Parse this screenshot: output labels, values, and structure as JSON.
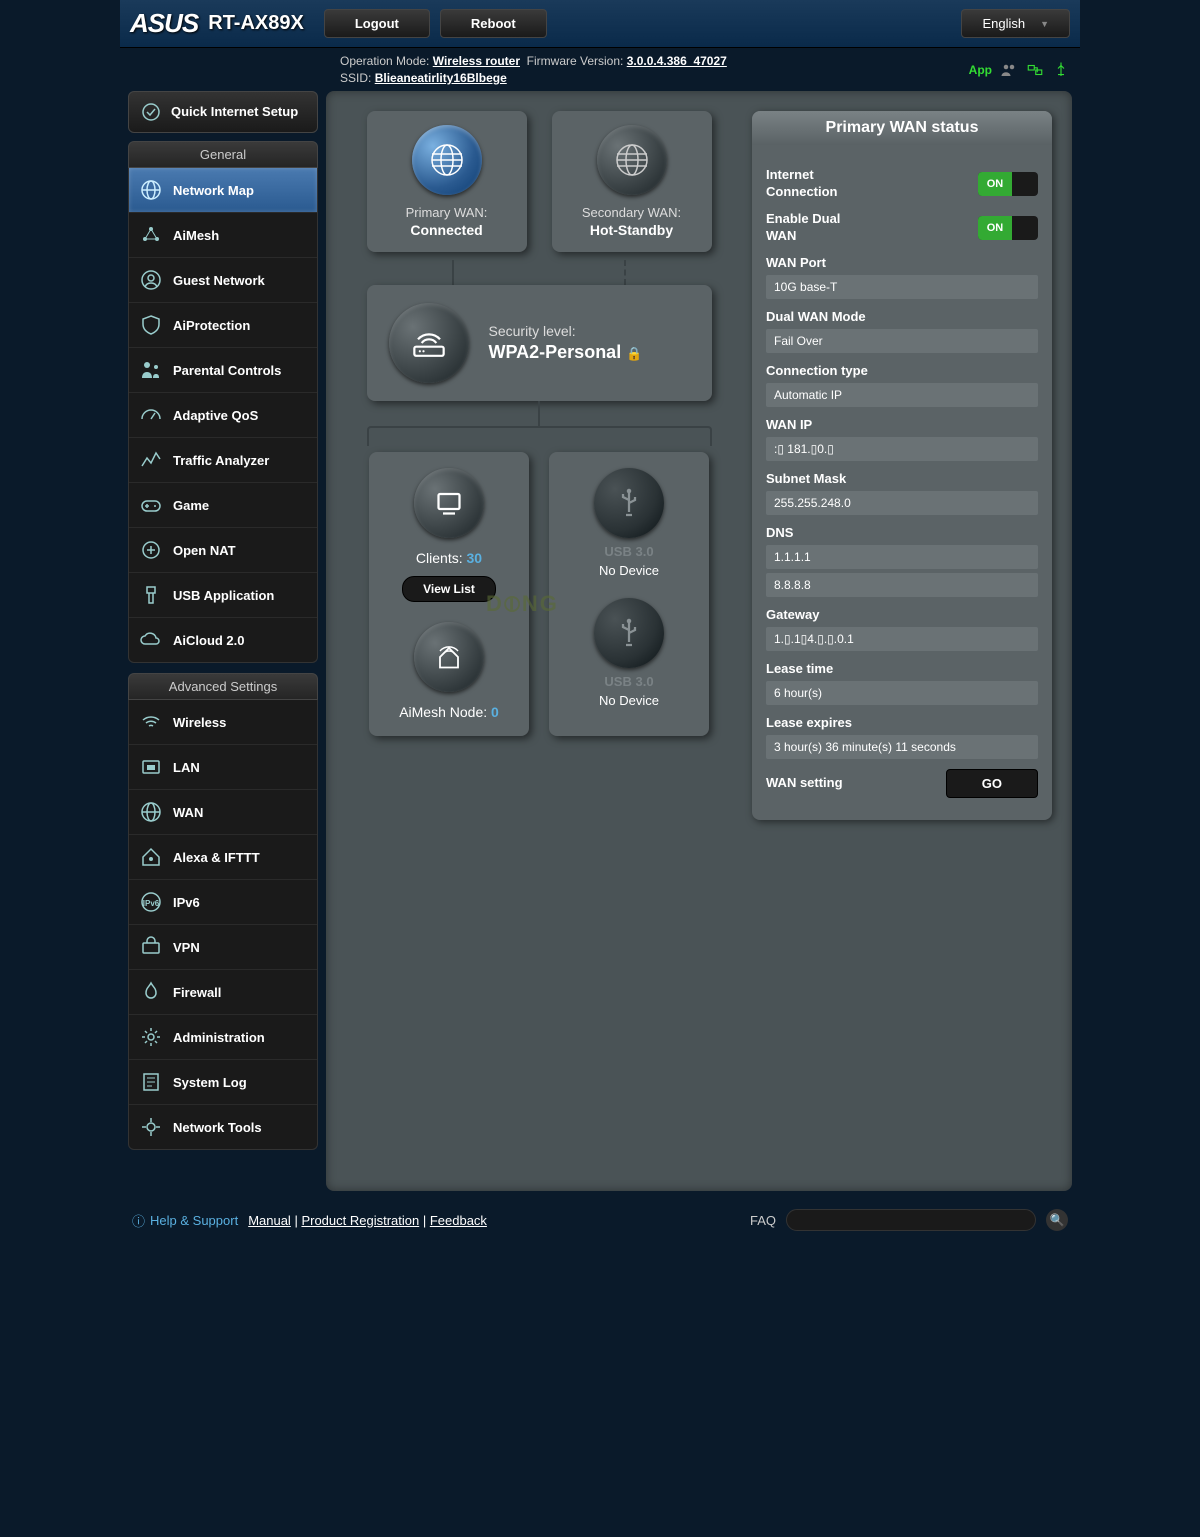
{
  "header": {
    "brand": "ASUS",
    "model": "RT-AX89X",
    "logout": "Logout",
    "reboot": "Reboot",
    "language": "English"
  },
  "status_bar": {
    "op_mode_label": "Operation Mode:",
    "op_mode": "Wireless router",
    "fw_label": "Firmware Version:",
    "fw": "3.0.0.4.386_47027",
    "ssid_label": "SSID:",
    "ssid": "Blieaneatirlity16Blbege",
    "app": "App"
  },
  "sidebar": {
    "qis": "Quick Internet Setup",
    "general_hdr": "General",
    "general": [
      "Network Map",
      "AiMesh",
      "Guest Network",
      "AiProtection",
      "Parental Controls",
      "Adaptive QoS",
      "Traffic Analyzer",
      "Game",
      "Open NAT",
      "USB Application",
      "AiCloud 2.0"
    ],
    "advanced_hdr": "Advanced Settings",
    "advanced": [
      "Wireless",
      "LAN",
      "WAN",
      "Alexa & IFTTT",
      "IPv6",
      "VPN",
      "Firewall",
      "Administration",
      "System Log",
      "Network Tools"
    ]
  },
  "diagram": {
    "primary_wan": {
      "title": "Primary WAN:",
      "status": "Connected"
    },
    "secondary_wan": {
      "title": "Secondary WAN:",
      "status": "Hot-Standby"
    },
    "security": {
      "label": "Security level:",
      "value": "WPA2-Personal"
    },
    "clients": {
      "label": "Clients:",
      "count": "30",
      "view_list": "View List"
    },
    "aimesh": {
      "label": "AiMesh Node:",
      "count": "0"
    },
    "usb1": {
      "label": "USB 3.0",
      "status": "No Device"
    },
    "usb2": {
      "label": "USB 3.0",
      "status": "No Device"
    }
  },
  "panel": {
    "title": "Primary WAN status",
    "internet_conn": "Internet Connection",
    "enable_dual": "Enable Dual WAN",
    "on_label": "ON",
    "fields": {
      "wan_port": {
        "label": "WAN Port",
        "value": "10G base-T"
      },
      "dual_mode": {
        "label": "Dual WAN Mode",
        "value": "Fail Over"
      },
      "conn_type": {
        "label": "Connection type",
        "value": "Automatic IP"
      },
      "wan_ip": {
        "label": "WAN IP",
        "value": ":▯ 181.▯0.▯"
      },
      "subnet": {
        "label": "Subnet Mask",
        "value": "255.255.248.0"
      },
      "dns": {
        "label": "DNS",
        "v1": "1.1.1.1",
        "v2": "8.8.8.8"
      },
      "gateway": {
        "label": "Gateway",
        "value": "1.▯.1▯4.▯.▯.0.1"
      },
      "lease_time": {
        "label": "Lease time",
        "value": "6 hour(s)"
      },
      "lease_exp": {
        "label": "Lease expires",
        "value": "3 hour(s) 36 minute(s) 11 seconds"
      }
    },
    "wan_setting": "WAN setting",
    "go": "GO"
  },
  "footer": {
    "help": "Help & Support",
    "manual": "Manual",
    "product_reg": "Product Registration",
    "feedback": "Feedback",
    "faq": "FAQ"
  },
  "watermark": "D⦶NG"
}
